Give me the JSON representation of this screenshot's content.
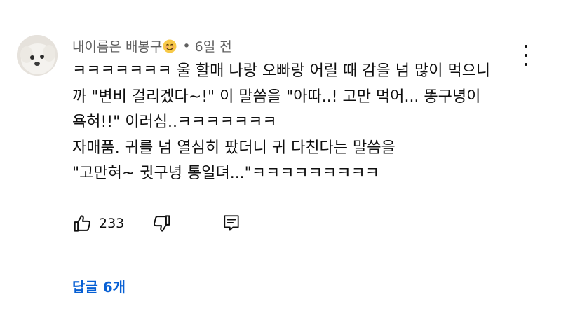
{
  "comment": {
    "author": "내이름은 배봉구",
    "author_emoji": "smiling-face-emoji",
    "separator": "•",
    "time": "6일 전",
    "lines": [
      "ㅋㅋㅋㅋㅋㅋㅋ 울 할매 나랑 오빠랑 어릴 때 감을 넘 많이 먹으니",
      "까 \"변비 걸리겠다~!\" 이 말씀을 \"아따..! 고만 먹어... 똥구녕이",
      "욕혀!!\" 이러심..ㅋㅋㅋㅋㅋㅋㅋ",
      "자매품.  귀를 넘 열심히 팠더니 귀 다친다는 말씀을",
      "\"고만혀~ 귓구녕 통일뎌...\"ㅋㅋㅋㅋㅋㅋㅋㅋㅋ"
    ],
    "like_count": "233",
    "replies_label": "답글 6개"
  },
  "icons": {
    "like": "thumbs-up-icon",
    "dislike": "thumbs-down-icon",
    "reply": "comment-icon",
    "more": "more-vertical-icon"
  },
  "colors": {
    "reply_link": "#065fd4",
    "meta_text": "#606060",
    "body_text": "#0f0f0f"
  }
}
